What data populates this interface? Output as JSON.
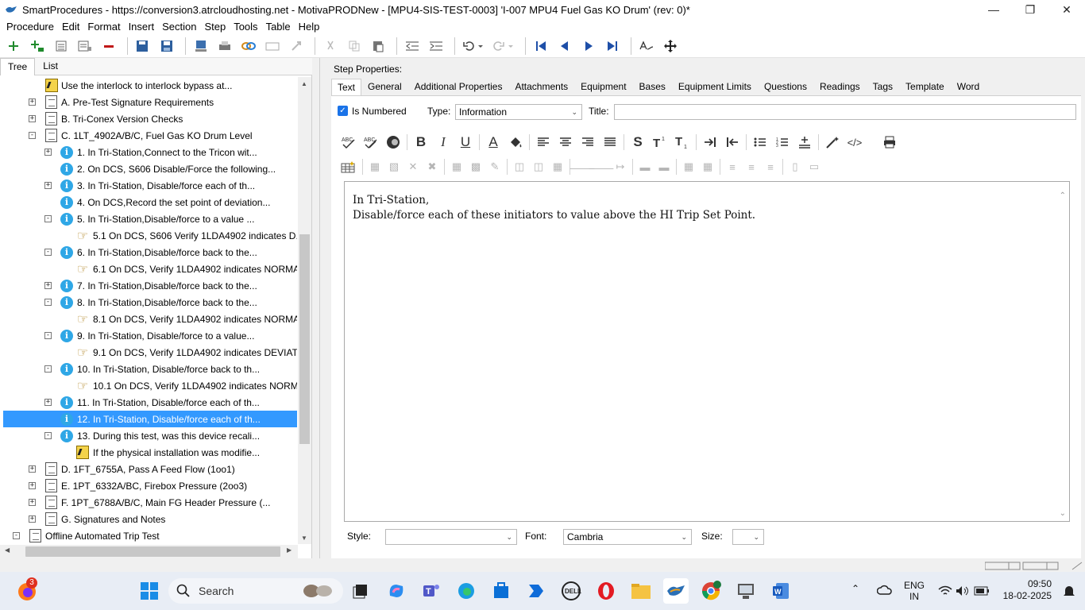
{
  "window": {
    "title": "SmartProcedures - https://conversion3.atrcloudhosting.net - MotivaPRODNew - [MPU4-SIS-TEST-0003] 'I-007 MPU4 Fuel Gas KO Drum' (rev: 0)*"
  },
  "menu": [
    "Procedure",
    "Edit",
    "Format",
    "Insert",
    "Section",
    "Step",
    "Tools",
    "Table",
    "Help"
  ],
  "left_tabs": [
    "Tree",
    "List"
  ],
  "tree": [
    {
      "label": "Use the interlock to interlock bypass at...",
      "icon": "warning-note-icon"
    },
    {
      "label": "A. Pre-Test Signature Requirements",
      "icon": "section-doc-icon"
    },
    {
      "label": "B. Tri-Conex Version Checks",
      "icon": "section-doc-icon"
    },
    {
      "label": "C. 1LT_4902A/B/C, Fuel Gas KO Drum Level",
      "icon": "section-doc-icon"
    },
    {
      "label": "1. In Tri-Station,Connect to the Tricon wit...",
      "icon": "info-icon"
    },
    {
      "label": "2. On DCS, S606 Disable/Force the following...",
      "icon": "info-icon"
    },
    {
      "label": "3. In Tri-Station, Disable/force each of th...",
      "icon": "info-icon"
    },
    {
      "label": "4. On DCS,Record the set point of deviation...",
      "icon": "info-icon"
    },
    {
      "label": "5. In Tri-Station,Disable/force to a value ...",
      "icon": "info-icon"
    },
    {
      "label": "5.1 On DCS, S606 Verify 1LDA4902 indicates D...",
      "icon": "pointing-hand-icon"
    },
    {
      "label": "6. In Tri-Station,Disable/force back to the...",
      "icon": "info-icon"
    },
    {
      "label": "6.1 On DCS, Verify 1LDA4902  indicates NORMA...",
      "icon": "pointing-hand-icon"
    },
    {
      "label": "7. In Tri-Station,Disable/force back to the...",
      "icon": "info-icon"
    },
    {
      "label": "8. In Tri-Station,Disable/force back to the...",
      "icon": "info-icon"
    },
    {
      "label": "8.1 On DCS, Verify 1LDA4902  indicates NORMA...",
      "icon": "pointing-hand-icon"
    },
    {
      "label": "9. In Tri-Station, Disable/force to a value...",
      "icon": "info-icon"
    },
    {
      "label": "9.1 On DCS, Verify 1LDA4902 indicates DEVIAT...",
      "icon": "pointing-hand-icon"
    },
    {
      "label": "10. In Tri-Station, Disable/force back to th...",
      "icon": "info-icon"
    },
    {
      "label": "10.1 On DCS, Verify 1LDA4902  indicates NORM...",
      "icon": "pointing-hand-icon"
    },
    {
      "label": "11. In Tri-Station, Disable/force each of th...",
      "icon": "info-icon"
    },
    {
      "label": "12. In Tri-Station, Disable/force each of th...",
      "icon": "info-icon"
    },
    {
      "label": "13. During this test, was this device recali...",
      "icon": "info-icon"
    },
    {
      "label": "If the physical installation was modifie...",
      "icon": "warning-note-icon"
    },
    {
      "label": "D. 1FT_6755A, Pass A Feed Flow (1oo1)",
      "icon": "section-doc-icon"
    },
    {
      "label": "E. 1PT_6332A/BC, Firebox Pressure (2oo3)",
      "icon": "section-doc-icon"
    },
    {
      "label": "F. 1PT_6788A/B/C, Main FG Header Pressure (...",
      "icon": "section-doc-icon"
    },
    {
      "label": "G. Signatures and Notes",
      "icon": "section-doc-icon"
    },
    {
      "label": "Offline Automated Trip Test",
      "icon": "section-doc-icon"
    }
  ],
  "step_properties": {
    "label": "Step Properties:",
    "tabs": [
      "Text",
      "General",
      "Additional Properties",
      "Attachments",
      "Equipment",
      "Bases",
      "Equipment Limits",
      "Questions",
      "Readings",
      "Tags",
      "Template",
      "Word"
    ],
    "is_numbered_label": "Is Numbered",
    "type_label": "Type:",
    "type_value": "Information",
    "title_label": "Title:",
    "title_value": "",
    "editor_lines": [
      "In Tri-Station,",
      "Disable/force each of these initiators to value above the HI Trip Set Point."
    ],
    "style_label": "Style:",
    "style_value": "",
    "font_label": "Font:",
    "font_value": "Cambria",
    "size_label": "Size:",
    "size_value": ""
  },
  "taskbar": {
    "search_placeholder": "Search",
    "notification_count": "3",
    "lang_top": "ENG",
    "lang_bottom": "IN",
    "time": "09:50",
    "date": "18-02-2025"
  },
  "colors": {
    "selection": "#3399ff",
    "info_icon": "#2fa7e6",
    "checkbox": "#1a73e8"
  }
}
